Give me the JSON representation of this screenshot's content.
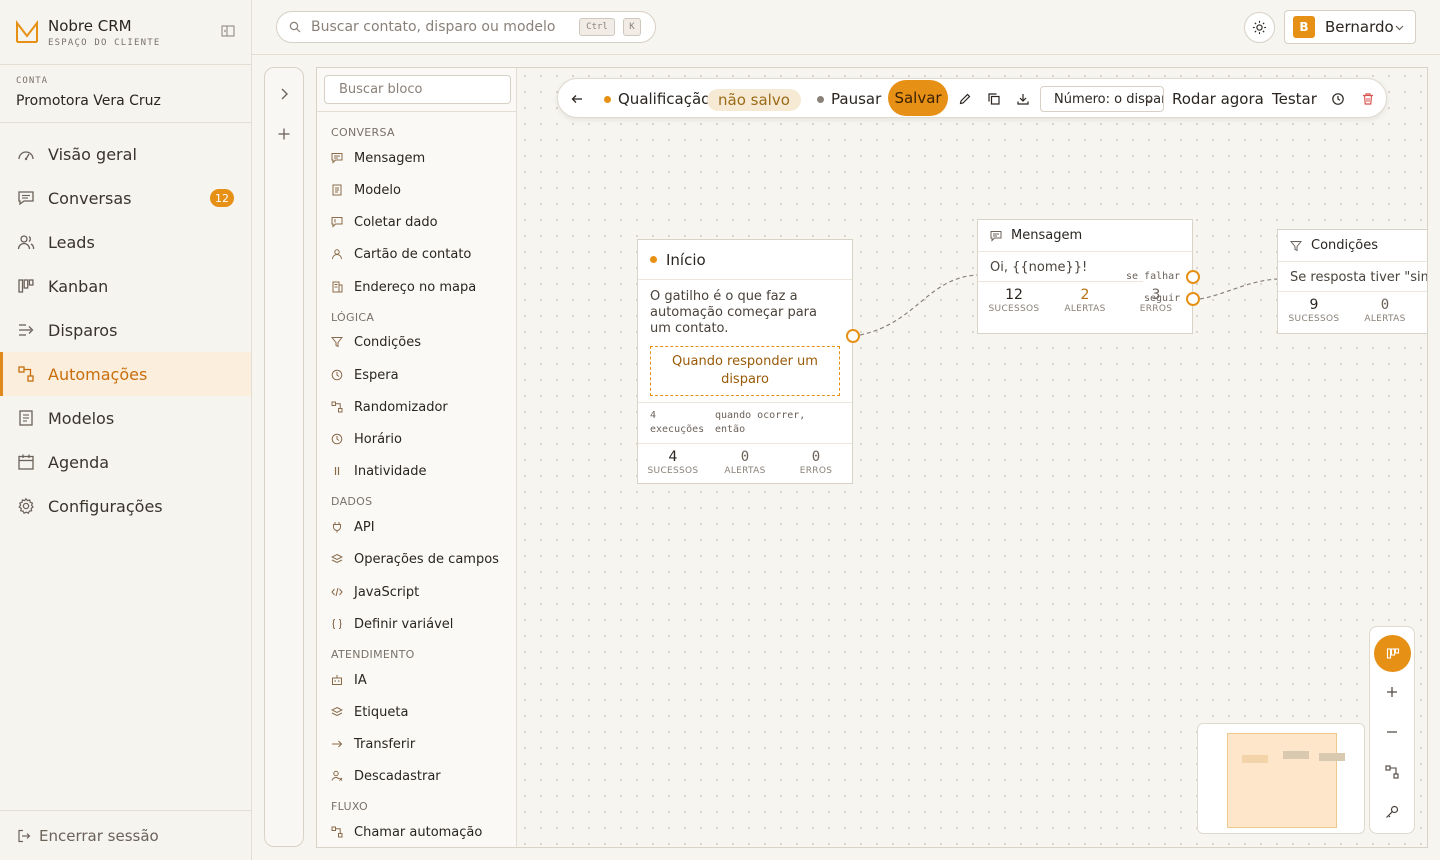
{
  "brand": {
    "name": "Nobre CRM",
    "subtitle": "ESPAÇO DO CLIENTE"
  },
  "account": {
    "label": "CONTA",
    "name": "Promotora Vera Cruz"
  },
  "nav": {
    "items": [
      {
        "label": "Visão geral",
        "icon": "dashboard-icon"
      },
      {
        "label": "Conversas",
        "icon": "chat-icon",
        "badge": "12"
      },
      {
        "label": "Leads",
        "icon": "users-icon"
      },
      {
        "label": "Kanban",
        "icon": "kanban-icon"
      },
      {
        "label": "Disparos",
        "icon": "send-icon"
      },
      {
        "label": "Automações",
        "icon": "workflow-icon",
        "active": true
      },
      {
        "label": "Modelos",
        "icon": "template-icon"
      },
      {
        "label": "Agenda",
        "icon": "calendar-icon"
      },
      {
        "label": "Configurações",
        "icon": "gear-icon"
      }
    ],
    "logout": "Encerrar sessão"
  },
  "topbar": {
    "search_placeholder": "Buscar contato, disparo ou modelo",
    "shortcut_key1": "Ctrl",
    "shortcut_key2": "K",
    "user_initial": "B",
    "user_name": "Bernardo"
  },
  "palette": {
    "search_placeholder": "Buscar bloco",
    "sections": [
      {
        "title": "CONVERSA",
        "items": [
          "Mensagem",
          "Modelo",
          "Coletar dado",
          "Cartão de contato",
          "Endereço no mapa"
        ]
      },
      {
        "title": "LÓGICA",
        "items": [
          "Condições",
          "Espera",
          "Randomizador",
          "Horário",
          "Inatividade"
        ]
      },
      {
        "title": "DADOS",
        "items": [
          "API",
          "Operações de campos",
          "JavaScript",
          "Definir variável"
        ]
      },
      {
        "title": "ATENDIMENTO",
        "items": [
          "IA",
          "Etiqueta",
          "Transferir",
          "Descadastrar"
        ]
      },
      {
        "title": "FLUXO",
        "items": [
          "Chamar automação"
        ]
      }
    ]
  },
  "toolbar": {
    "flow_name": "Qualificação",
    "unsaved": "não salvo",
    "pause": "Pausar",
    "save": "Salvar",
    "number_select": "Número: o disparo",
    "run_now": "Rodar agora",
    "test": "Testar"
  },
  "nodes": {
    "start": {
      "title": "Início",
      "description": "O gatilho é o que faz a automação começar para um contato.",
      "trigger": "Quando responder um disparo",
      "exec_count": "4",
      "exec_label": "execuções",
      "when_line1": "quando ocorrer,",
      "when_line2": "então",
      "stats": {
        "success": "4",
        "alerts": "0",
        "errors": "0"
      }
    },
    "message": {
      "title": "Mensagem",
      "text": "Oi, {{nome}}!",
      "port_fail": "se falhar",
      "port_next": "seguir",
      "stats": {
        "success": "12",
        "alerts": "2",
        "errors": "3"
      }
    },
    "conditions": {
      "title": "Condições",
      "text": "Se resposta tiver \"sim\"",
      "stats": {
        "success": "9",
        "alerts": "0"
      }
    },
    "stat_labels": {
      "success": "SUCESSOS",
      "alerts": "ALERTAS",
      "errors": "ERROS"
    }
  },
  "colors": {
    "accent": "#e69016",
    "active_bg": "#fbeedd",
    "text": "#2a2520"
  }
}
